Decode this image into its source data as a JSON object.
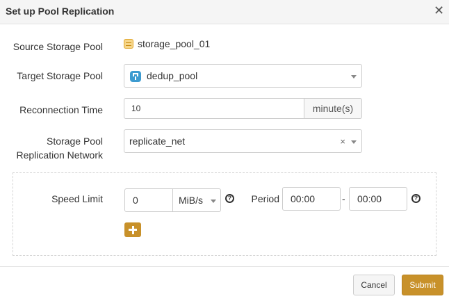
{
  "dialog": {
    "title": "Set up Pool Replication",
    "close_icon": "close-icon"
  },
  "form": {
    "source_pool_label": "Source Storage Pool",
    "source_pool_value": "storage_pool_01",
    "target_pool_label": "Target Storage Pool",
    "target_pool_value": "dedup_pool",
    "reconnection_label": "Reconnection Time",
    "reconnection_value": "10",
    "reconnection_unit": "minute(s)",
    "network_label_line1": "Storage Pool",
    "network_label_line2": "Replication Network",
    "network_value": "replicate_net",
    "network_clear": "×"
  },
  "speed": {
    "label": "Speed Limit",
    "value": "0",
    "unit": "MiB/s",
    "period_label": "Period",
    "period_start": "00:00",
    "period_separator": "-",
    "period_end": "00:00",
    "help_glyph": "?"
  },
  "footer": {
    "cancel_label": "Cancel",
    "submit_label": "Submit"
  },
  "colors": {
    "accent": "#c8912a",
    "border": "#cccccc",
    "header_bg": "#f5f5f5"
  }
}
